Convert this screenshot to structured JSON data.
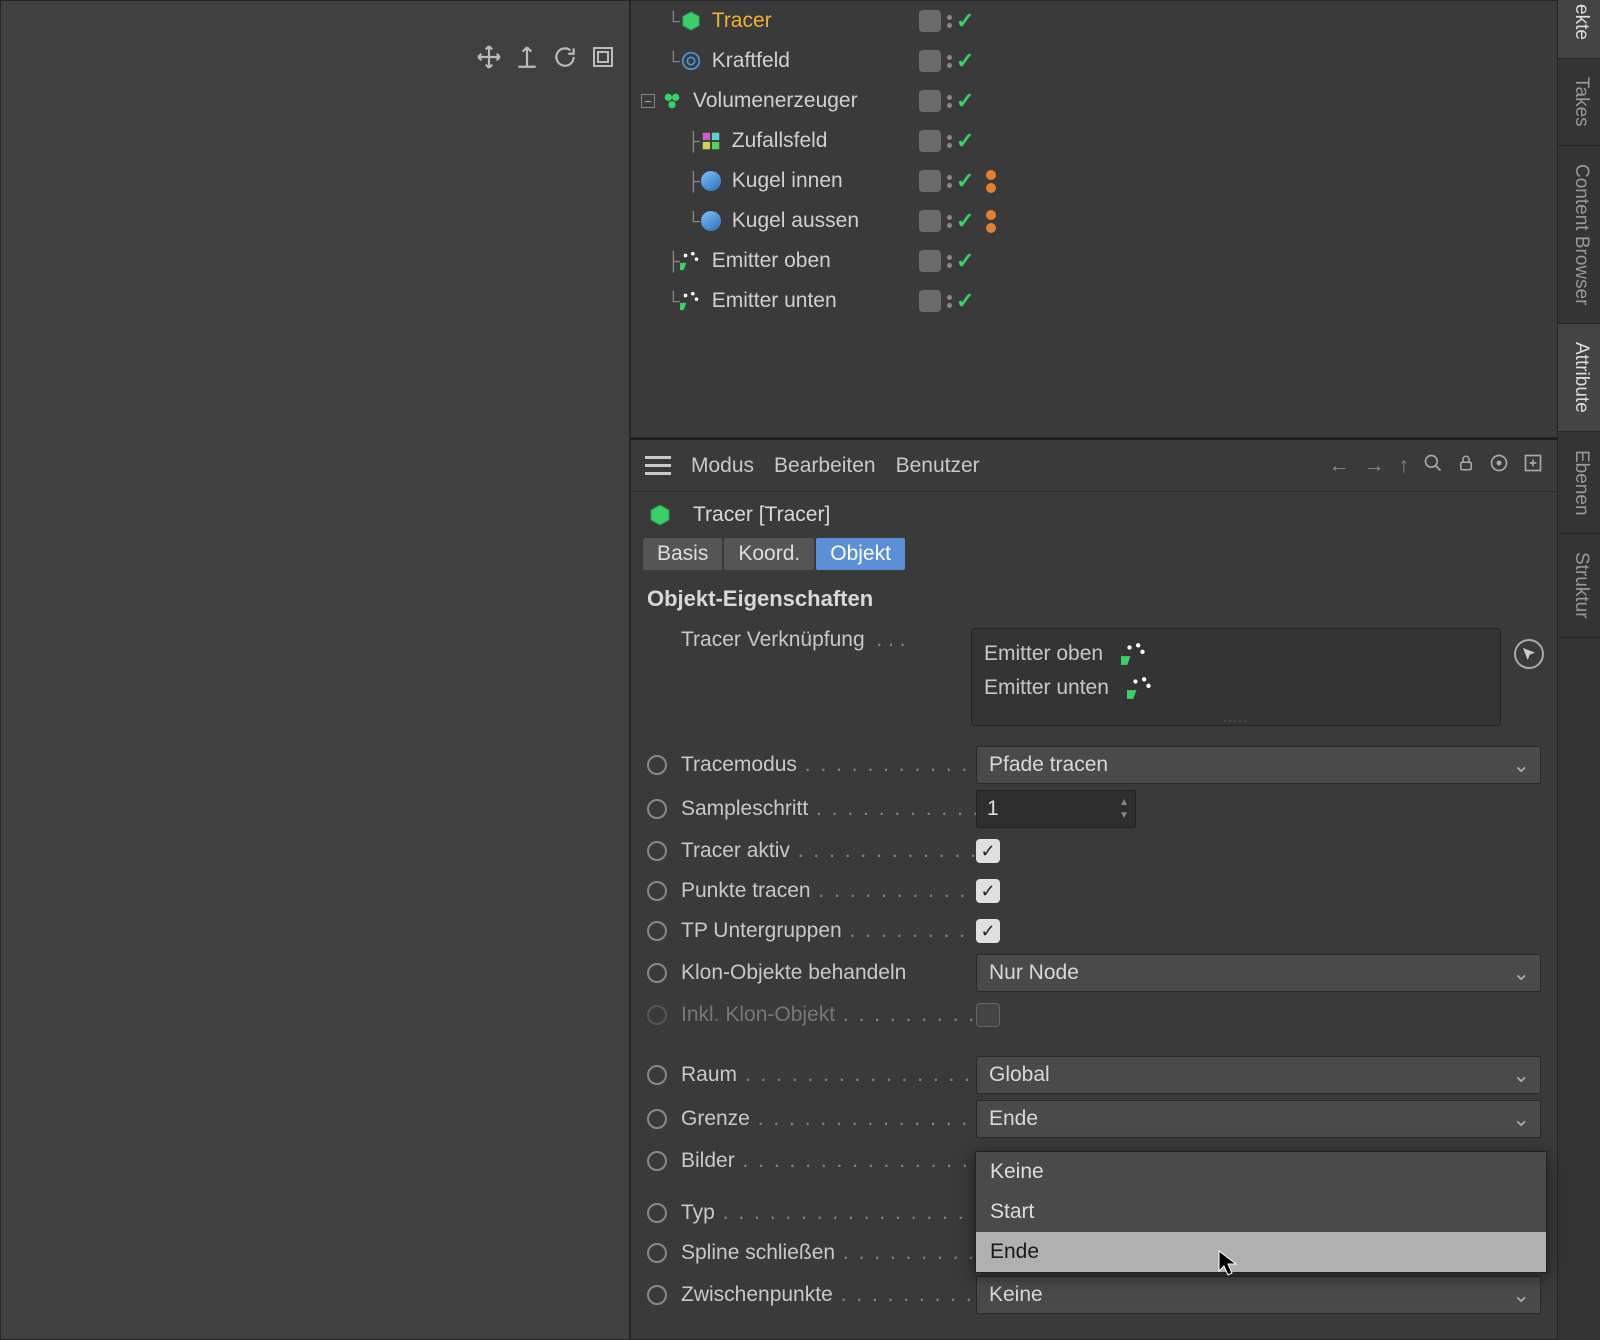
{
  "tree": {
    "items": [
      {
        "name": "Tracer",
        "selected": true,
        "indent": 36,
        "icon": "cube-green"
      },
      {
        "name": "Kraftfeld",
        "indent": 36,
        "icon": "field"
      },
      {
        "name": "Volumenerzeuger",
        "indent": 20,
        "icon": "volume",
        "expander": "-"
      },
      {
        "name": "Zufallsfeld",
        "indent": 56,
        "icon": "random"
      },
      {
        "name": "Kugel innen",
        "indent": 56,
        "icon": "sphere",
        "orange": true
      },
      {
        "name": "Kugel aussen",
        "indent": 56,
        "icon": "sphere",
        "orange": true
      },
      {
        "name": "Emitter oben",
        "indent": 36,
        "icon": "emitter"
      },
      {
        "name": "Emitter unten",
        "indent": 36,
        "icon": "emitter"
      }
    ]
  },
  "attr": {
    "menu": {
      "modus": "Modus",
      "bearbeiten": "Bearbeiten",
      "benutzer": "Benutzer"
    },
    "header": "Tracer [Tracer]",
    "tabs": {
      "basis": "Basis",
      "koord": "Koord.",
      "objekt": "Objekt"
    },
    "section": "Objekt-Eigenschaften",
    "link_label": "Tracer Verknüpfung",
    "link_items": [
      {
        "name": "Emitter oben"
      },
      {
        "name": "Emitter unten"
      }
    ],
    "props": {
      "tracemodus": {
        "label": "Tracemodus",
        "value": "Pfade tracen"
      },
      "sampleschritt": {
        "label": "Sampleschritt",
        "value": "1"
      },
      "tracer_aktiv": {
        "label": "Tracer aktiv",
        "checked": true
      },
      "punkte_tracen": {
        "label": "Punkte tracen",
        "checked": true
      },
      "tp_untergruppen": {
        "label": "TP Untergruppen",
        "checked": true
      },
      "klon_behandeln": {
        "label": "Klon-Objekte behandeln",
        "value": "Nur Node"
      },
      "inkl_klon": {
        "label": "Inkl. Klon-Objekt",
        "checked": false
      },
      "raum": {
        "label": "Raum",
        "value": "Global"
      },
      "grenze": {
        "label": "Grenze",
        "value": "Ende"
      },
      "bilder": {
        "label": "Bilder"
      },
      "typ": {
        "label": "Typ"
      },
      "spline_schliessen": {
        "label": "Spline schließen"
      },
      "zwischenpunkte": {
        "label": "Zwischenpunkte",
        "value": "Keine"
      }
    },
    "popup": {
      "keine": "Keine",
      "start": "Start",
      "ende": "Ende"
    }
  },
  "sidetabs": {
    "objekte": "ekte",
    "takes": "Takes",
    "content": "Content Browser",
    "attribute": "Attribute",
    "ebenen": "Ebenen",
    "struktur": "Struktur"
  }
}
